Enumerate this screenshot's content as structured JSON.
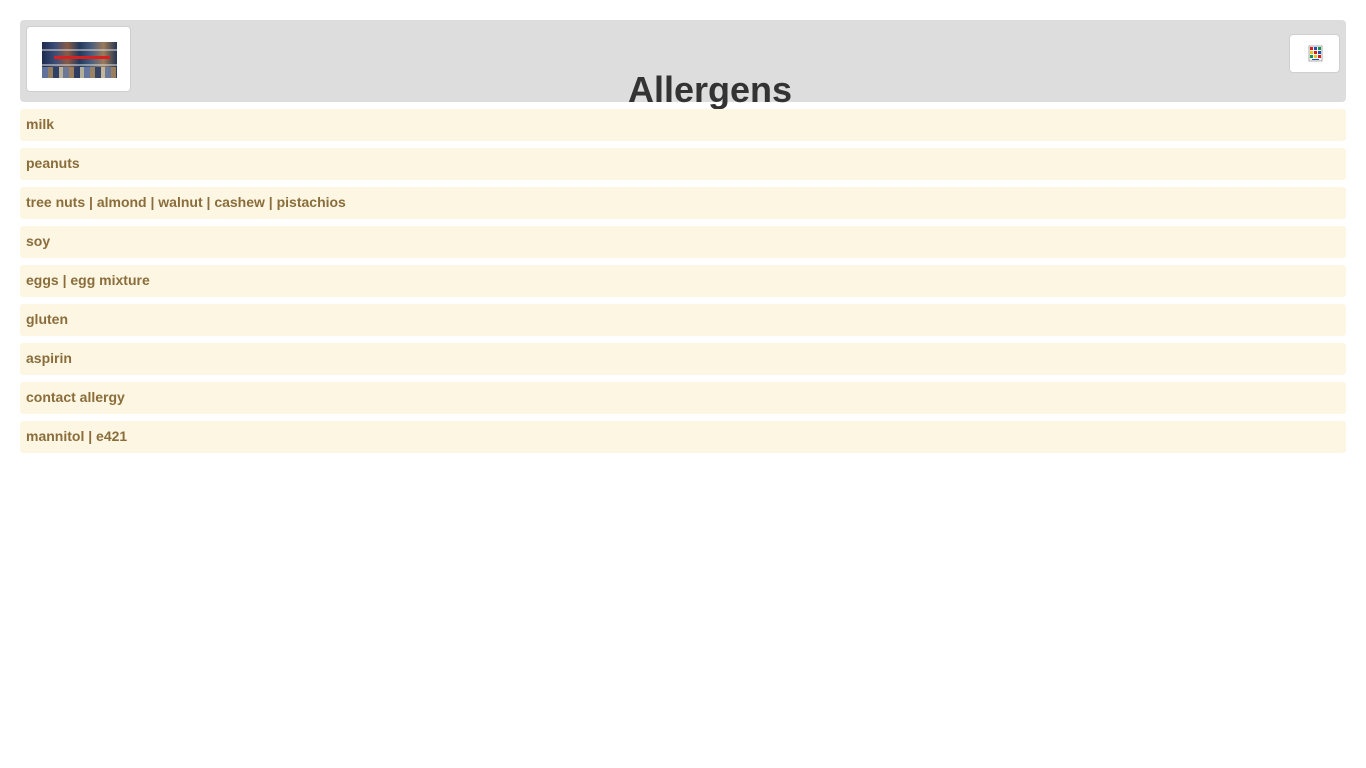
{
  "header": {
    "title": "Allergens",
    "logo": {
      "icon": "store-shelf-photo-icon"
    },
    "language_button": {
      "icon": "multicolor-flag-icon"
    }
  },
  "allergens": [
    {
      "label": "milk"
    },
    {
      "label": "peanuts"
    },
    {
      "label": "tree nuts | almond | walnut | cashew | pistachios"
    },
    {
      "label": "soy"
    },
    {
      "label": "eggs | egg mixture"
    },
    {
      "label": "gluten"
    },
    {
      "label": "aspirin"
    },
    {
      "label": "contact allergy"
    },
    {
      "label": "mannitol | e421"
    }
  ],
  "colors": {
    "header_background": "#dddddd",
    "item_background": "#fcf6e3",
    "item_text": "#8a6d3b",
    "title_text": "#333333"
  }
}
